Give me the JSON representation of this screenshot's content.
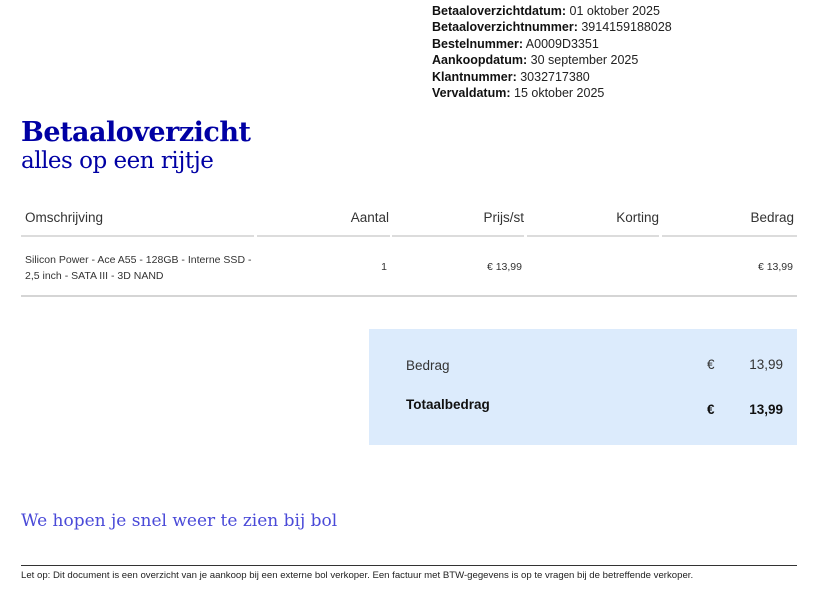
{
  "meta": [
    {
      "label": "Betaaloverzichtdatum:",
      "value": "01 oktober 2025"
    },
    {
      "label": "Betaaloverzichtnummer:",
      "value": "3914159188028"
    },
    {
      "label": "Bestelnummer:",
      "value": "A0009D3351"
    },
    {
      "label": "Aankoopdatum:",
      "value": "30 september 2025"
    },
    {
      "label": "Klantnummer:",
      "value": "3032717380"
    },
    {
      "label": "Vervaldatum:",
      "value": "15 oktober 2025"
    }
  ],
  "title": "Betaaloverzicht",
  "subtitle": "alles op een rijtje",
  "table": {
    "headers": {
      "description": "Omschrijving",
      "quantity": "Aantal",
      "price": "Prijs/st",
      "discount": "Korting",
      "amount": "Bedrag"
    },
    "rows": [
      {
        "description": "Silicon Power - Ace A55 - 128GB - Interne SSD - 2,5 inch - SATA III - 3D NAND",
        "quantity": "1",
        "price": "€ 13,99",
        "discount": "",
        "amount": "€ 13,99"
      }
    ]
  },
  "summary": {
    "subtotal_label": "Bedrag",
    "subtotal_currency": "€",
    "subtotal_value": "13,99",
    "total_label": "Totaalbedrag",
    "total_currency": "€",
    "total_value": "13,99"
  },
  "goodbye": "We hopen je snel weer te zien bij bol",
  "footer": "Let op: Dit document is een overzicht van je aankoop bij een externe bol verkoper. Een factuur met BTW-gegevens is op te vragen bij de betreffende verkoper.",
  "colors": {
    "brand": "#0000a4",
    "goodbye": "#4a4ad8",
    "summary_bg": "#dcebfc"
  }
}
